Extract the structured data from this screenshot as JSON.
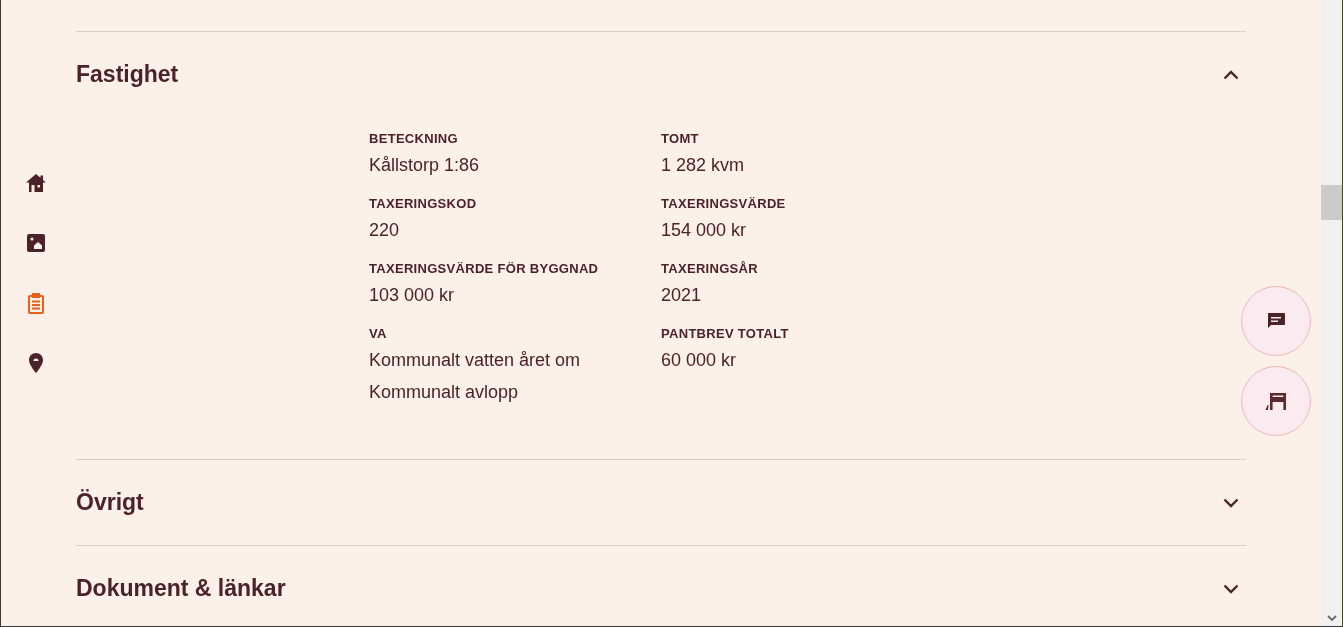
{
  "nav": [
    {
      "selected": false
    },
    {
      "selected": false
    },
    {
      "selected": true
    },
    {
      "selected": false
    }
  ],
  "sections": [
    {
      "title": "Fastighet",
      "expanded": true,
      "fields": [
        {
          "label": "BETECKNING",
          "values": [
            "Kållstorp 1:86"
          ]
        },
        {
          "label": "TOMT",
          "values": [
            "1 282 kvm"
          ]
        },
        {
          "label": "TAXERINGSKOD",
          "values": [
            "220"
          ]
        },
        {
          "label": "TAXERINGSVÄRDE",
          "values": [
            "154 000 kr"
          ]
        },
        {
          "label": "TAXERINGSVÄRDE FÖR BYGGNAD",
          "values": [
            "103 000 kr"
          ]
        },
        {
          "label": "TAXERINGSÅR",
          "values": [
            "2021"
          ]
        },
        {
          "label": "VA",
          "values": [
            "Kommunalt vatten året om",
            "Kommunalt avlopp"
          ]
        },
        {
          "label": "PANTBREV TOTALT",
          "values": [
            "60 000 kr"
          ]
        }
      ]
    },
    {
      "title": "Övrigt",
      "expanded": false
    },
    {
      "title": "Dokument & länkar",
      "expanded": false
    }
  ]
}
